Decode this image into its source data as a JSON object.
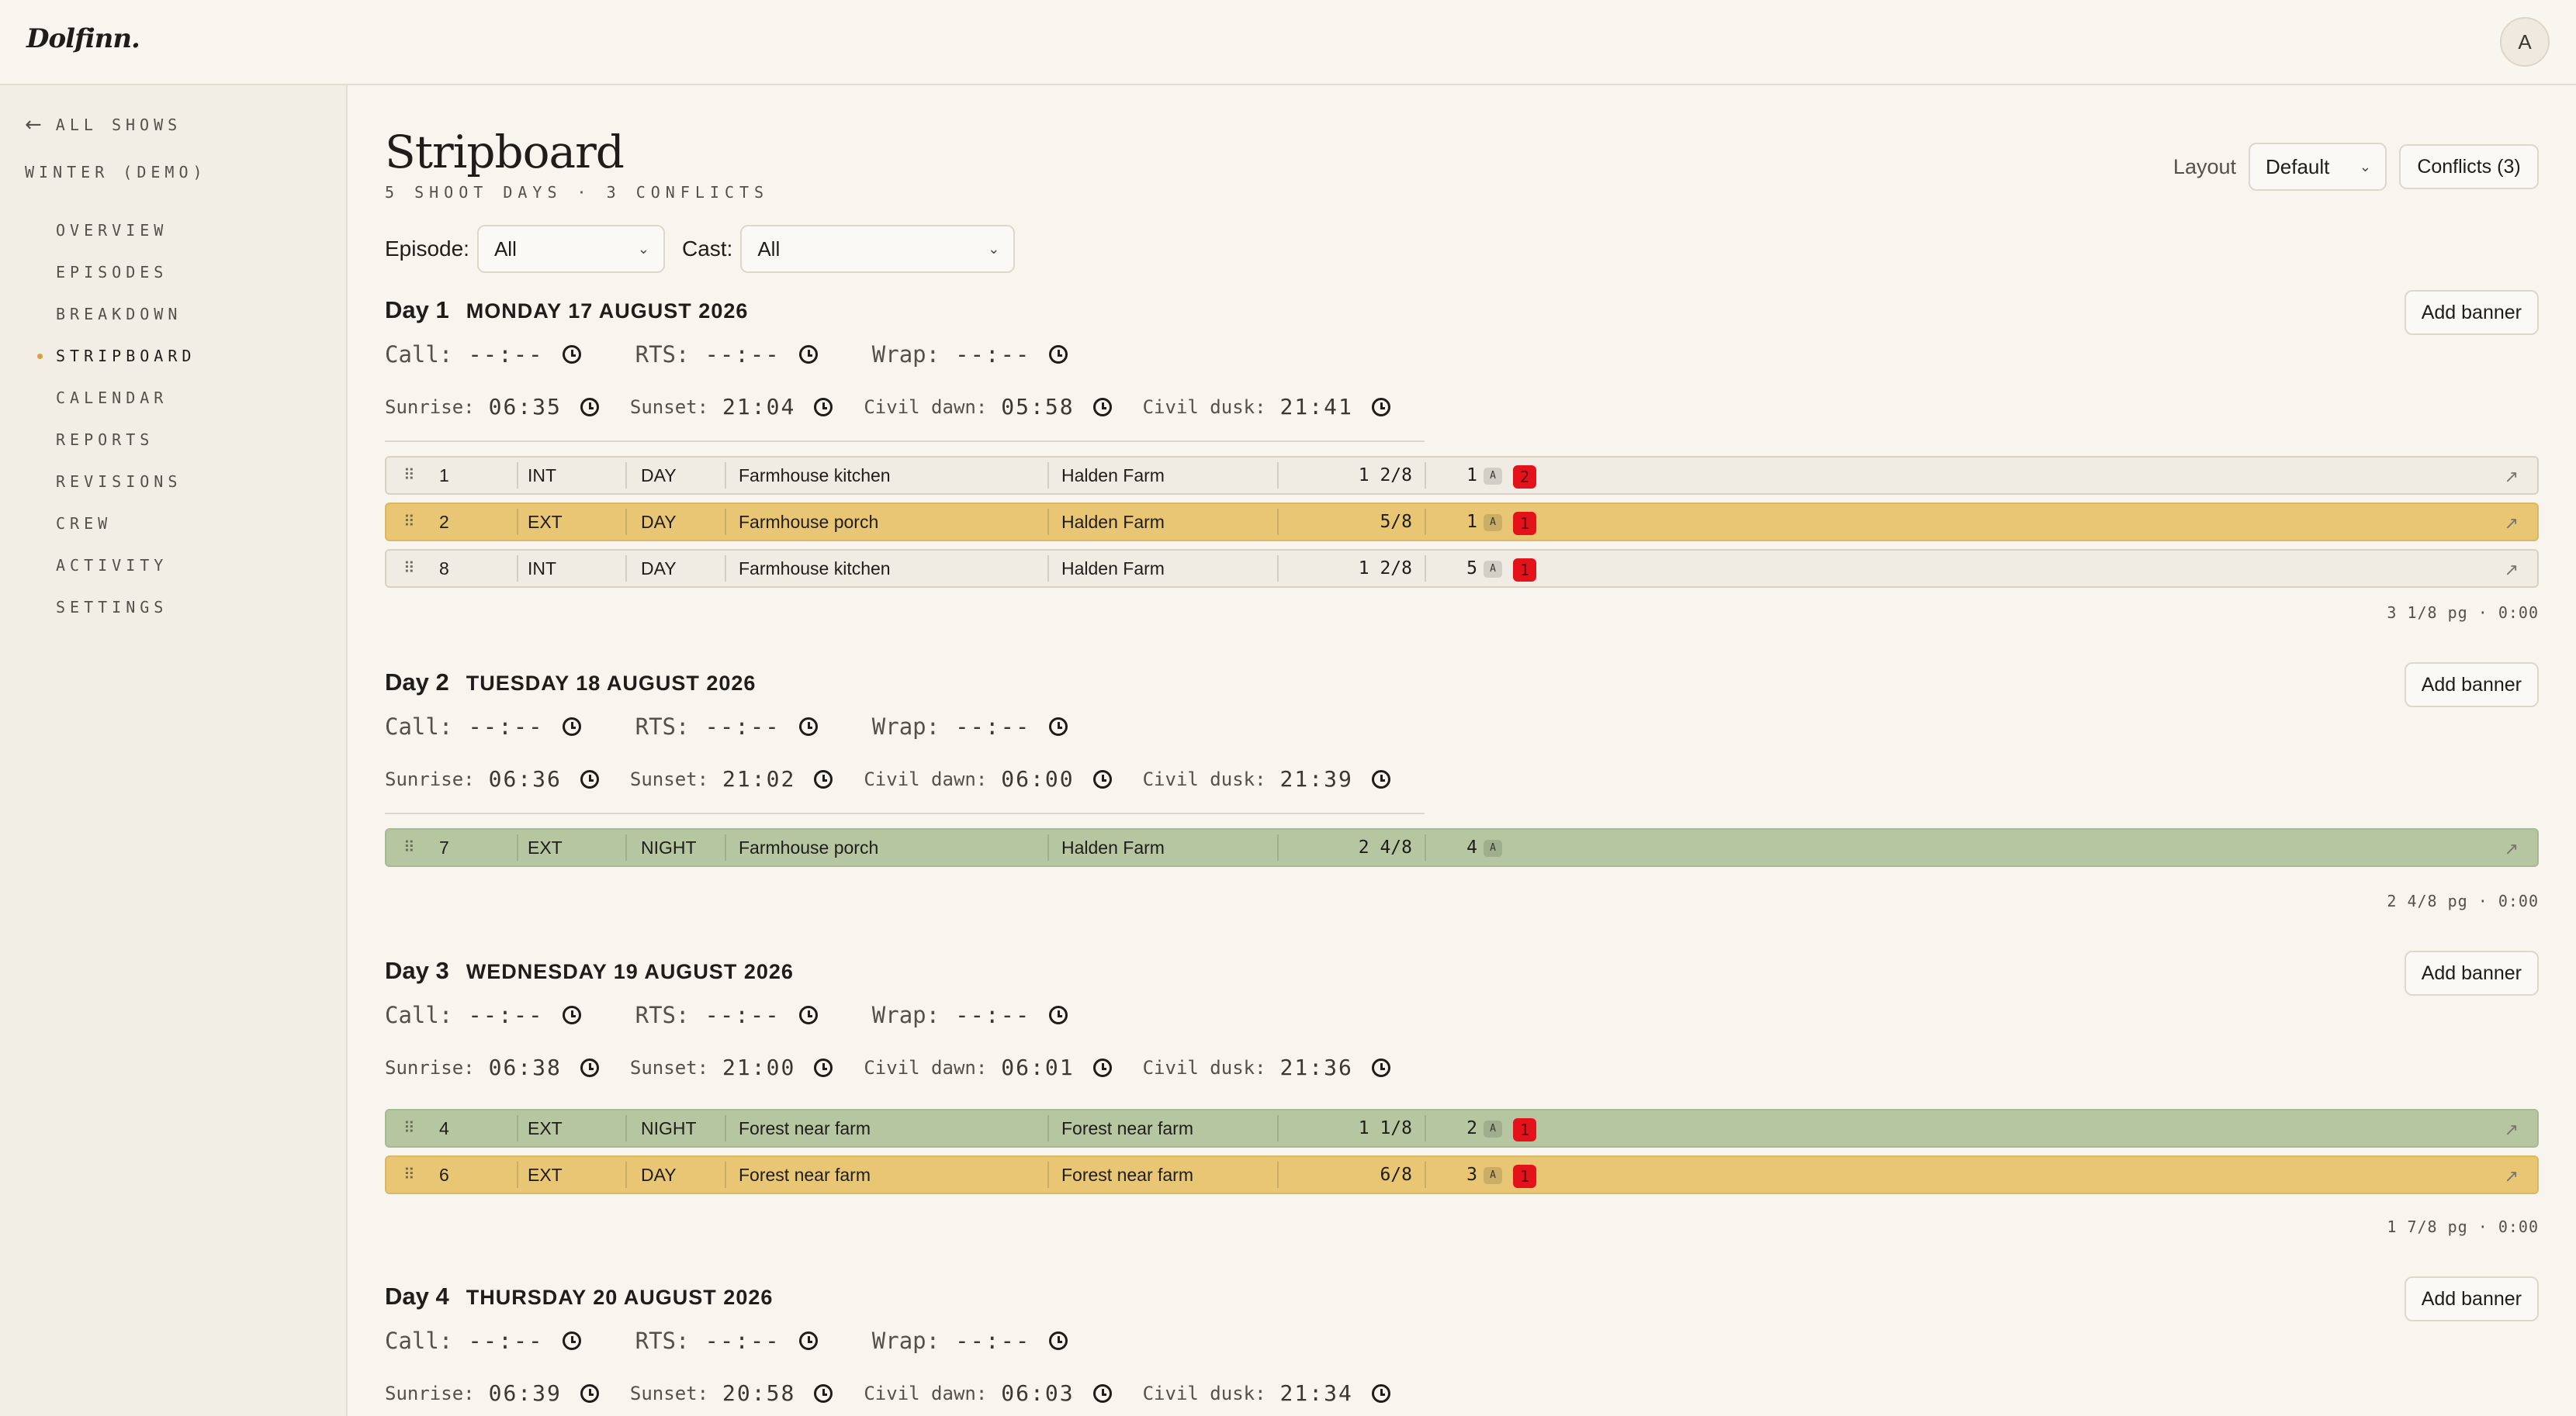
{
  "app": {
    "logo": "Dolfinn.",
    "avatar_initial": "A"
  },
  "sidebar": {
    "back_label": "ALL SHOWS",
    "show_name": "WINTER (DEMO)",
    "items": [
      {
        "label": "OVERVIEW"
      },
      {
        "label": "EPISODES"
      },
      {
        "label": "BREAKDOWN"
      },
      {
        "label": "STRIPBOARD",
        "active": true
      },
      {
        "label": "CALENDAR"
      },
      {
        "label": "REPORTS"
      },
      {
        "label": "REVISIONS"
      },
      {
        "label": "CREW"
      },
      {
        "label": "ACTIVITY"
      },
      {
        "label": "SETTINGS"
      }
    ]
  },
  "header": {
    "title": "Stripboard",
    "subtitle": "5 SHOOT DAYS · 3 CONFLICTS",
    "layout_label": "Layout",
    "layout_value": "Default",
    "conflicts_button": "Conflicts (3)"
  },
  "filters": {
    "episode_label": "Episode:",
    "episode_value": "All",
    "cast_label": "Cast:",
    "cast_value": "All"
  },
  "labels": {
    "call": "Call:",
    "rts": "RTS:",
    "wrap": "Wrap:",
    "sunrise": "Sunrise:",
    "sunset": "Sunset:",
    "civil_dawn": "Civil dawn:",
    "civil_dusk": "Civil dusk:",
    "add_banner": "Add banner"
  },
  "colors": {
    "yellow_strip": "#e8c673",
    "green_strip": "#b6c6a1",
    "plain_strip": "#f1ece3",
    "conflict": "#e3121b",
    "accent_dot": "#d8a043"
  },
  "days": [
    {
      "num": "Day 1",
      "date": "MONDAY 17 AUGUST 2026",
      "call": "--:--",
      "rts": "--:--",
      "wrap": "--:--",
      "sunrise": "06:35",
      "sunset": "21:04",
      "civil_dawn": "05:58",
      "civil_dusk": "21:41",
      "summary": "3 1/8 pg · 0:00",
      "strips": [
        {
          "scene": "1",
          "ie": "INT",
          "dn": "DAY",
          "set": "Farmhouse kitchen",
          "location": "Halden Farm",
          "pages": "1 2/8",
          "cast": "1",
          "badge": "A",
          "conflicts": "2",
          "color": "plain"
        },
        {
          "scene": "2",
          "ie": "EXT",
          "dn": "DAY",
          "set": "Farmhouse porch",
          "location": "Halden Farm",
          "pages": "5/8",
          "cast": "1",
          "badge": "A",
          "conflicts": "1",
          "color": "yellow"
        },
        {
          "scene": "8",
          "ie": "INT",
          "dn": "DAY",
          "set": "Farmhouse kitchen",
          "location": "Halden Farm",
          "pages": "1 2/8",
          "cast": "5",
          "badge": "A",
          "conflicts": "1",
          "color": "plain"
        }
      ]
    },
    {
      "num": "Day 2",
      "date": "TUESDAY 18 AUGUST 2026",
      "call": "--:--",
      "rts": "--:--",
      "wrap": "--:--",
      "sunrise": "06:36",
      "sunset": "21:02",
      "civil_dawn": "06:00",
      "civil_dusk": "21:39",
      "summary": "2 4/8 pg · 0:00",
      "strips": [
        {
          "scene": "7",
          "ie": "EXT",
          "dn": "NIGHT",
          "set": "Farmhouse porch",
          "location": "Halden Farm",
          "pages": "2 4/8",
          "cast": "4",
          "badge": "A",
          "conflicts": "",
          "color": "green"
        }
      ]
    },
    {
      "num": "Day 3",
      "date": "WEDNESDAY 19 AUGUST 2026",
      "call": "--:--",
      "rts": "--:--",
      "wrap": "--:--",
      "sunrise": "06:38",
      "sunset": "21:00",
      "civil_dawn": "06:01",
      "civil_dusk": "21:36",
      "summary": "1 7/8 pg · 0:00",
      "strips": [
        {
          "scene": "4",
          "ie": "EXT",
          "dn": "NIGHT",
          "set": "Forest near farm",
          "location": "Forest near farm",
          "pages": "1 1/8",
          "cast": "2",
          "badge": "A",
          "conflicts": "1",
          "color": "green"
        },
        {
          "scene": "6",
          "ie": "EXT",
          "dn": "DAY",
          "set": "Forest near farm",
          "location": "Forest near farm",
          "pages": "6/8",
          "cast": "3",
          "badge": "A",
          "conflicts": "1",
          "color": "yellow"
        }
      ]
    },
    {
      "num": "Day 4",
      "date": "THURSDAY 20 AUGUST 2026",
      "call": "--:--",
      "rts": "--:--",
      "wrap": "--:--",
      "sunrise": "06:39",
      "sunset": "20:58",
      "civil_dawn": "06:03",
      "civil_dusk": "21:34",
      "summary": "",
      "strips": []
    }
  ]
}
